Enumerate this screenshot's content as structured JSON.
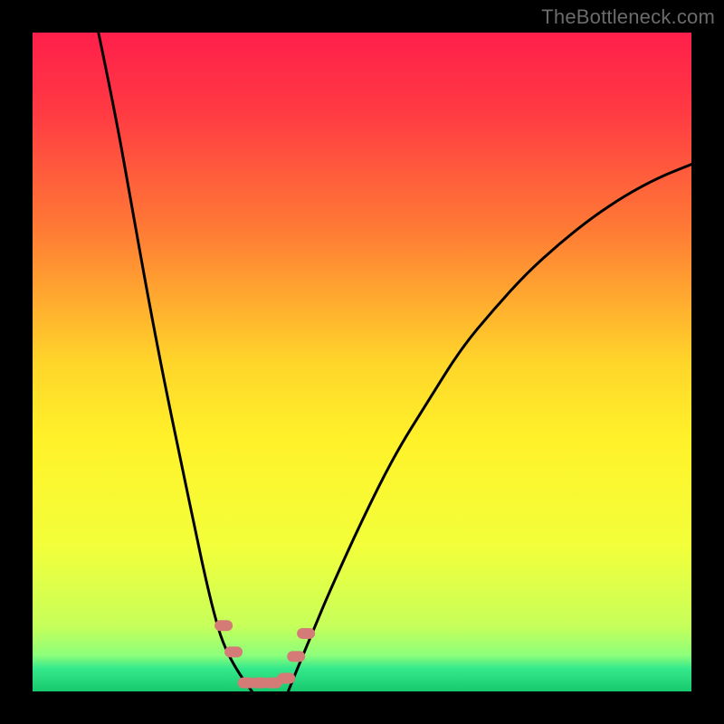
{
  "watermark": "TheBottleneck.com",
  "chart_data": {
    "type": "line",
    "title": "",
    "xlabel": "",
    "ylabel": "",
    "xlim": [
      0,
      100
    ],
    "ylim": [
      0,
      100
    ],
    "background_gradient": [
      {
        "stop": 0.0,
        "color": "#ff1f4b"
      },
      {
        "stop": 0.12,
        "color": "#ff3a43"
      },
      {
        "stop": 0.3,
        "color": "#ff7b35"
      },
      {
        "stop": 0.5,
        "color": "#ffd52a"
      },
      {
        "stop": 0.62,
        "color": "#fff22a"
      },
      {
        "stop": 0.78,
        "color": "#f2ff3a"
      },
      {
        "stop": 0.9,
        "color": "#c7ff5a"
      },
      {
        "stop": 0.945,
        "color": "#8dff7a"
      },
      {
        "stop": 0.965,
        "color": "#35e98b"
      },
      {
        "stop": 1.0,
        "color": "#17c96e"
      }
    ],
    "series": [
      {
        "name": "left-curve",
        "x": [
          10.0,
          12.5,
          15.0,
          17.5,
          20.0,
          22.5,
          25.0,
          26.3,
          27.5,
          28.8,
          30.8,
          33.3
        ],
        "y": [
          100.0,
          88.0,
          74.0,
          60.0,
          47.0,
          35.0,
          23.0,
          17.0,
          12.0,
          7.5,
          3.5,
          0.0
        ]
      },
      {
        "name": "right-curve",
        "x": [
          38.8,
          40.0,
          42.5,
          45.0,
          50.0,
          55.0,
          60.0,
          65.0,
          70.0,
          75.0,
          80.0,
          85.0,
          90.0,
          95.0,
          100.0
        ],
        "y": [
          0.0,
          3.0,
          9.0,
          15.0,
          26.0,
          36.0,
          44.0,
          52.0,
          58.0,
          63.5,
          68.0,
          72.0,
          75.3,
          78.0,
          80.0
        ]
      }
    ],
    "markers": [
      {
        "x": 29.0,
        "y": 10.0
      },
      {
        "x": 30.5,
        "y": 6.0
      },
      {
        "x": 32.5,
        "y": 1.3
      },
      {
        "x": 34.5,
        "y": 1.3
      },
      {
        "x": 36.5,
        "y": 1.3
      },
      {
        "x": 38.5,
        "y": 2.0
      },
      {
        "x": 40.0,
        "y": 5.3
      },
      {
        "x": 41.5,
        "y": 8.8
      }
    ],
    "marker_color": "#d47a77"
  }
}
